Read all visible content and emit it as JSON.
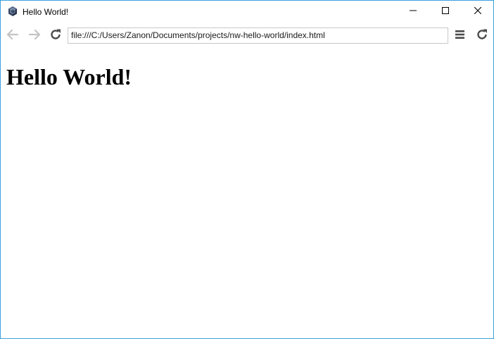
{
  "window": {
    "title": "Hello World!",
    "app_icon": "nwjs-hexagon-icon",
    "controls": {
      "minimize_icon": "minimize-icon",
      "maximize_icon": "maximize-icon",
      "close_icon": "close-icon"
    },
    "border_color": "#3aa0e0"
  },
  "toolbar": {
    "back_icon": "arrow-left-icon",
    "forward_icon": "arrow-right-icon",
    "reload_icon": "reload-icon",
    "address": "file:///C:/Users/Zanon/Documents/projects/nw-hello-world/index.html",
    "menu_icon": "hamburger-menu-icon",
    "reload_app_icon": "reload-icon"
  },
  "content": {
    "heading": "Hello World!"
  }
}
